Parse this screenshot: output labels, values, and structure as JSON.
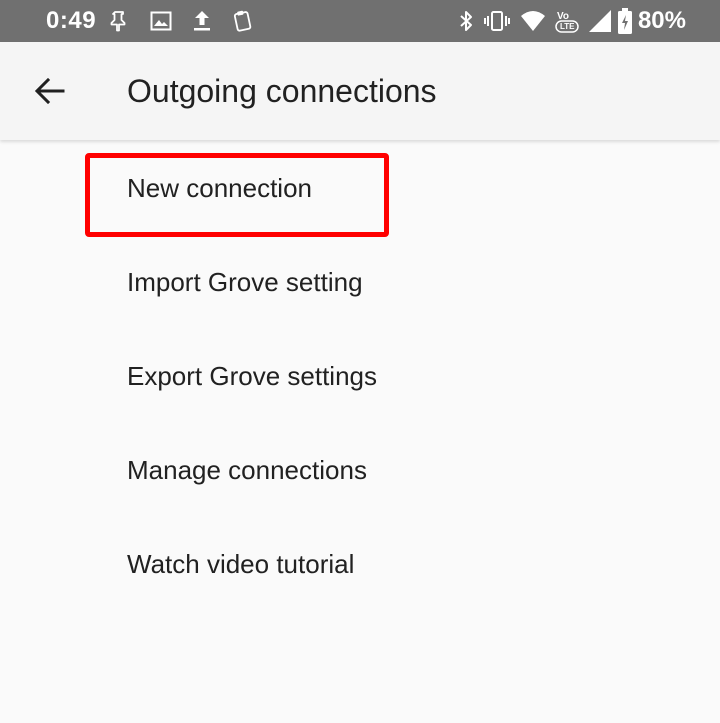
{
  "status_bar": {
    "time": "0:49",
    "battery_percent": "80%",
    "left_icons": [
      "pin-icon",
      "image-icon",
      "upload-icon",
      "clipboard-icon"
    ],
    "right_icons": [
      "bluetooth-icon",
      "vibrate-icon",
      "wifi-icon",
      "volte-icon",
      "signal-icon",
      "battery-charging-icon"
    ],
    "volte_text": "LTE"
  },
  "app_bar": {
    "title": "Outgoing connections",
    "back_icon": "arrow-back-icon"
  },
  "menu": {
    "items": [
      {
        "label": "New connection"
      },
      {
        "label": "Import Grove setting"
      },
      {
        "label": "Export Grove settings"
      },
      {
        "label": "Manage connections"
      },
      {
        "label": "Watch video tutorial"
      }
    ]
  },
  "colors": {
    "status_bar_bg": "#707070",
    "app_bar_bg": "#f5f5f5",
    "page_bg": "#fafafa",
    "text_primary": "#212121",
    "highlight": "#ff0000"
  }
}
